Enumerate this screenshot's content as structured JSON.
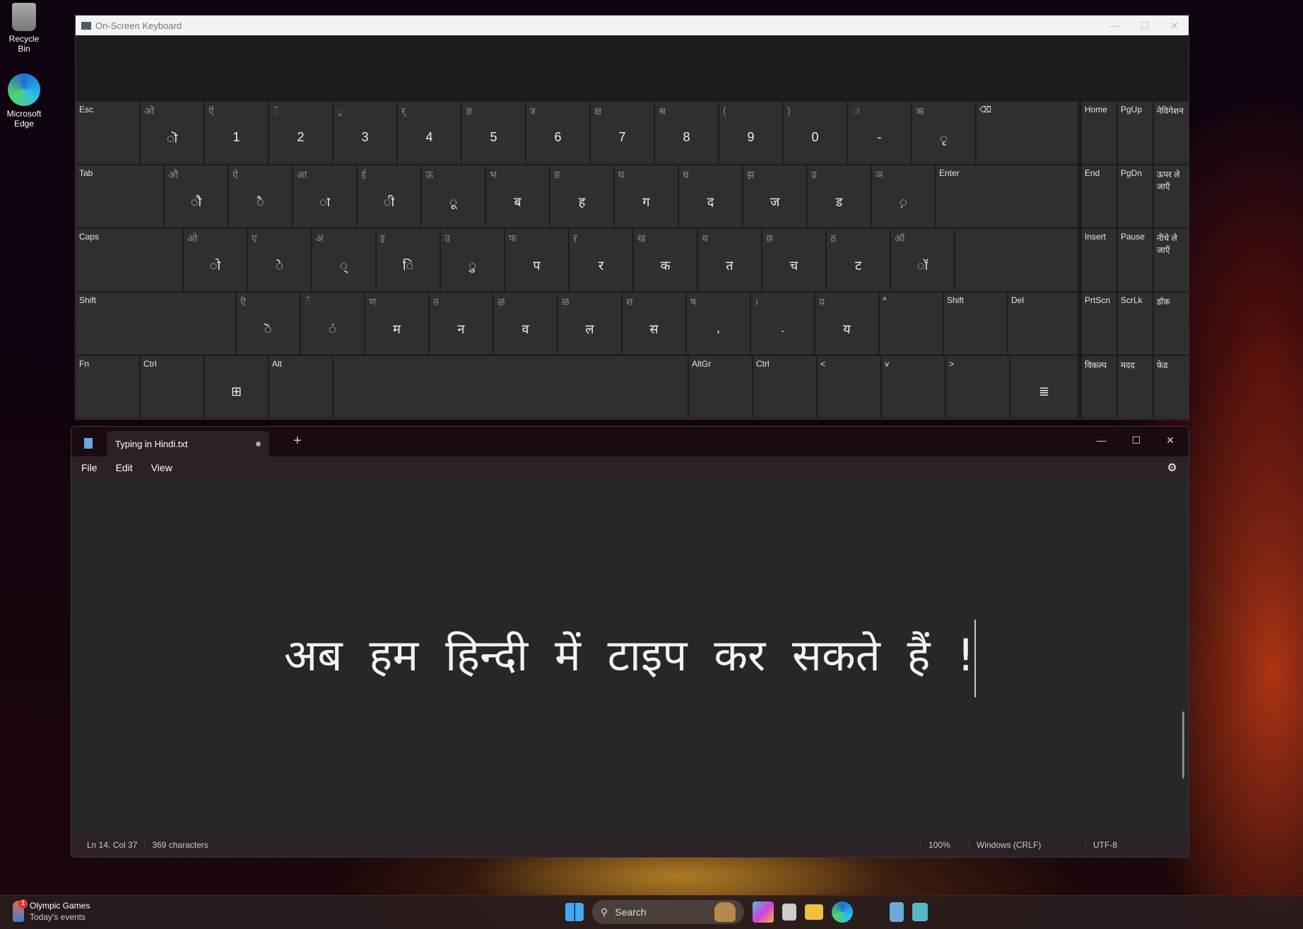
{
  "desktop": {
    "icons": [
      {
        "label": "Recycle Bin"
      },
      {
        "label": "Microsoft Edge"
      }
    ]
  },
  "osk": {
    "title": "On-Screen Keyboard",
    "rows": [
      [
        {
          "n": "Esc"
        },
        {
          "t": "ओ",
          "m": "ॊ"
        },
        {
          "t": "ऍ",
          "m": "1"
        },
        {
          "t": "ॅ",
          "m": "2"
        },
        {
          "t": "्र",
          "m": "3"
        },
        {
          "t": "र्",
          "m": "4"
        },
        {
          "t": "ज्ञ",
          "m": "5"
        },
        {
          "t": "त्र",
          "m": "6"
        },
        {
          "t": "क्ष",
          "m": "7"
        },
        {
          "t": "श्र",
          "m": "8"
        },
        {
          "t": "(",
          "m": "9"
        },
        {
          "t": ")",
          "m": "0"
        },
        {
          "t": "ः",
          "m": "-"
        },
        {
          "t": "ऋ",
          "m": "ृ"
        },
        {
          "n": "⌫"
        }
      ],
      [
        {
          "n": "Tab"
        },
        {
          "t": "औ",
          "m": "ौ"
        },
        {
          "t": "ऐ",
          "m": "ै"
        },
        {
          "t": "आ",
          "m": "ा"
        },
        {
          "t": "ई",
          "m": "ी"
        },
        {
          "t": "ऊ",
          "m": "ू"
        },
        {
          "t": "भ",
          "m": "ब"
        },
        {
          "t": "ङ",
          "m": "ह"
        },
        {
          "t": "घ",
          "m": "ग"
        },
        {
          "t": "ध",
          "m": "द"
        },
        {
          "t": "झ",
          "m": "ज"
        },
        {
          "t": "ढ",
          "m": "ड"
        },
        {
          "t": "ञ",
          "m": "़"
        },
        {
          "n": "Enter"
        }
      ],
      [
        {
          "n": "Caps"
        },
        {
          "t": "ओ",
          "m": "ो"
        },
        {
          "t": "ए",
          "m": "े"
        },
        {
          "t": "अ",
          "m": "्"
        },
        {
          "t": "इ",
          "m": "ि"
        },
        {
          "t": "उ",
          "m": "ु"
        },
        {
          "t": "फ",
          "m": "प"
        },
        {
          "t": "ऱ",
          "m": "र"
        },
        {
          "t": "ख",
          "m": "क"
        },
        {
          "t": "थ",
          "m": "त"
        },
        {
          "t": "छ",
          "m": "च"
        },
        {
          "t": "ठ",
          "m": "ट"
        },
        {
          "t": "ऑ",
          "m": "ॉ"
        },
        {}
      ],
      [
        {
          "n": "Shift"
        },
        {
          "t": "ऎ",
          "m": "ॆ"
        },
        {
          "t": "ँ",
          "m": "ं"
        },
        {
          "t": "ण",
          "m": "म"
        },
        {
          "t": "ऩ",
          "m": "न"
        },
        {
          "t": "ऴ",
          "m": "व"
        },
        {
          "t": "ळ",
          "m": "ल"
        },
        {
          "t": "श",
          "m": "स"
        },
        {
          "t": "ष",
          "m": ","
        },
        {
          "t": "।",
          "m": "."
        },
        {
          "t": "य़",
          "m": "य"
        },
        {
          "n": "^"
        },
        {
          "n": "Shift"
        },
        {
          "n": "Del"
        }
      ],
      [
        {
          "n": "Fn"
        },
        {
          "n": "Ctrl"
        },
        {
          "m": "⊞"
        },
        {
          "n": "Alt"
        },
        {},
        {
          "n": "AltGr"
        },
        {
          "n": "Ctrl"
        },
        {
          "n": "<"
        },
        {
          "n": "v"
        },
        {
          "n": ">"
        },
        {
          "m": "≣"
        }
      ]
    ],
    "side": [
      "Home",
      "PgUp",
      "नेविगेशन",
      "End",
      "PgDn",
      "ऊपर ले जाएँ",
      "Insert",
      "Pause",
      "नीचे ले जाएँ",
      "PrtScn",
      "ScrLk",
      "डॉक",
      "विकल्प",
      "मदद",
      "फ़ेड"
    ]
  },
  "notepad": {
    "tab_title": "Typing in Hindi.txt",
    "menu": [
      "File",
      "Edit",
      "View"
    ],
    "content": "अब हम हिन्दी में टाइप कर सकते हैं !",
    "status": {
      "position": "Ln 14, Col 37",
      "characters": "369 characters",
      "zoom": "100%",
      "line_ending": "Windows (CRLF)",
      "encoding": "UTF-8"
    }
  },
  "taskbar": {
    "widget_title": "Olympic Games",
    "widget_subtitle": "Today's events",
    "widget_badge": "1",
    "search_label": "Search"
  }
}
